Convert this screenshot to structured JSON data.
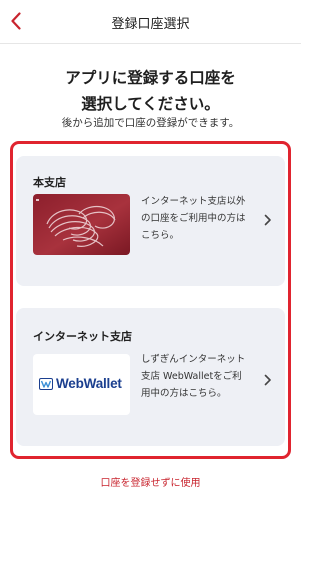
{
  "header": {
    "title": "登録口座選択"
  },
  "intro": {
    "line1": "アプリに登録する口座を",
    "line2": "選択してください。",
    "note": "後から追加で口座の登録ができます。"
  },
  "options": [
    {
      "title": "本支店",
      "desc": [
        "インターネット支店以外",
        "の口座をご利用中の方は",
        "こちら。"
      ]
    },
    {
      "title": "インターネット支店",
      "logo_text": "WebWallet",
      "desc": [
        "しずぎんインターネット",
        "支店 WebWalletをご利",
        "用中の方はこちら。"
      ]
    }
  ],
  "footer": {
    "skip_label": "口座を登録せずに使用"
  },
  "colors": {
    "accent": "#e0242f",
    "skip_text": "#c8242e",
    "card_bg": "#eef0f5",
    "logo_blue": "#1b3f8f"
  },
  "icons": [
    "back-chevron-icon",
    "chevron-right-icon",
    "webwallet-logo-icon"
  ]
}
